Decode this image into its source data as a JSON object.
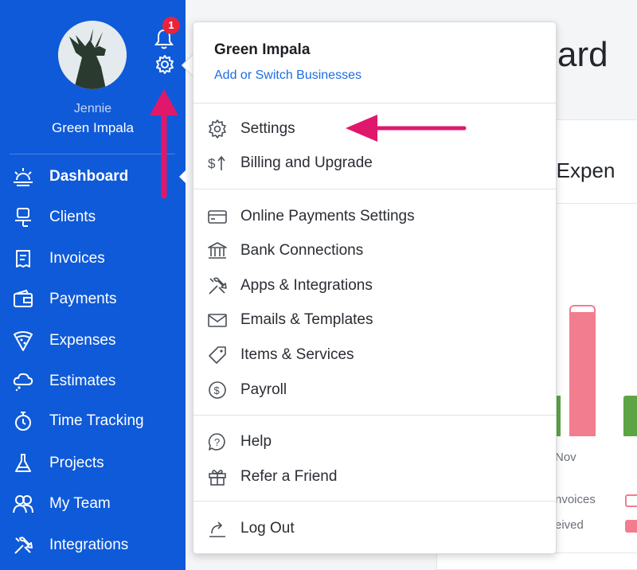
{
  "sidebar": {
    "user_name": "Jennie",
    "business_name": "Green Impala",
    "notification_count": "1",
    "nav": [
      {
        "label": "Dashboard",
        "icon": "sunrise-icon",
        "active": true
      },
      {
        "label": "Clients",
        "icon": "client-icon"
      },
      {
        "label": "Invoices",
        "icon": "invoice-icon"
      },
      {
        "label": "Payments",
        "icon": "wallet-icon"
      },
      {
        "label": "Expenses",
        "icon": "expense-icon"
      },
      {
        "label": "Estimates",
        "icon": "estimate-icon"
      },
      {
        "label": "Time Tracking",
        "icon": "stopwatch-icon"
      },
      {
        "label": "Projects",
        "icon": "flask-icon"
      },
      {
        "label": "My Team",
        "icon": "team-icon"
      },
      {
        "label": "Integrations",
        "icon": "tools-icon"
      }
    ]
  },
  "background": {
    "title_fragment": "ard",
    "subtitle_fragment": "d Expen",
    "axis_label": "Nov",
    "legend_a": "nvoices",
    "legend_b": "eived"
  },
  "menu": {
    "business_name": "Green Impala",
    "switch_link": "Add or Switch Businesses",
    "items": [
      {
        "label": "Settings",
        "icon": "gear-icon"
      },
      {
        "label": "Billing and Upgrade",
        "icon": "dollar-arrow-icon"
      },
      {
        "label": "Online Payments Settings",
        "icon": "credit-card-icon"
      },
      {
        "label": "Bank Connections",
        "icon": "bank-icon"
      },
      {
        "label": "Apps & Integrations",
        "icon": "tools-icon"
      },
      {
        "label": "Emails & Templates",
        "icon": "envelope-icon"
      },
      {
        "label": "Items & Services",
        "icon": "tag-icon"
      },
      {
        "label": "Payroll",
        "icon": "dollar-circle-icon"
      },
      {
        "label": "Help",
        "icon": "help-icon"
      },
      {
        "label": "Refer a Friend",
        "icon": "gift-icon"
      },
      {
        "label": "Log Out",
        "icon": "logout-icon"
      }
    ]
  },
  "colors": {
    "sidebar_bg": "#0f5ad8",
    "link_blue": "#1f6de0",
    "annotation_pink": "#e0186c",
    "badge_red": "#e8243d"
  }
}
